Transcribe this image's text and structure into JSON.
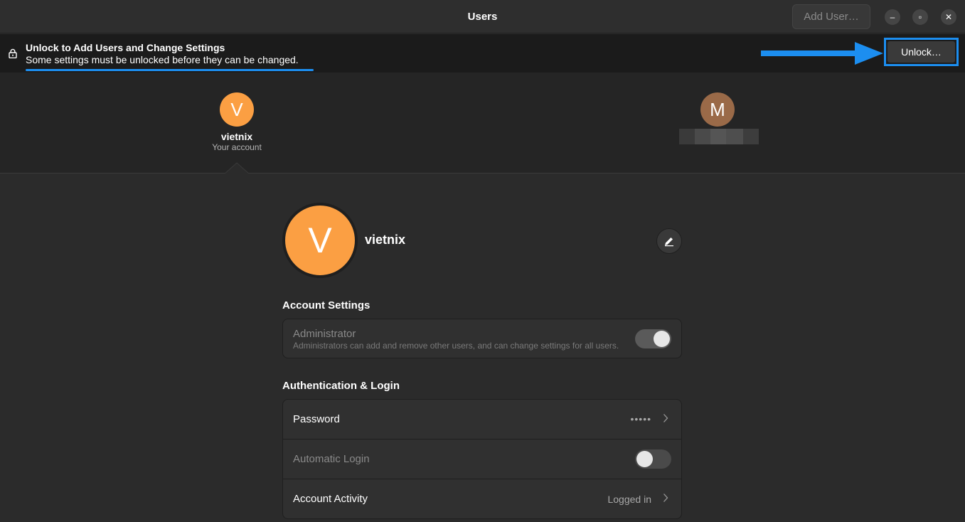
{
  "window": {
    "title": "Users",
    "add_user_label": "Add User…",
    "minimize_glyph": "–",
    "maximize_glyph": "▫",
    "close_glyph": "✕"
  },
  "banner": {
    "icon": "lock-icon",
    "title": "Unlock to Add Users and Change Settings",
    "subtitle": "Some settings must be unlocked before they can be changed.",
    "unlock_label": "Unlock…",
    "highlight_color": "#1c8ef0"
  },
  "users": [
    {
      "initial": "V",
      "name": "vietnix",
      "subtitle": "Your account",
      "color": "#fb9f43"
    },
    {
      "initial": "M",
      "name": "",
      "subtitle": "",
      "color": "#9a6a48"
    }
  ],
  "profile": {
    "initial": "V",
    "name": "vietnix",
    "color": "#fb9f43",
    "edit_icon": "pencil-icon"
  },
  "account_settings": {
    "heading": "Account Settings",
    "administrator": {
      "label": "Administrator",
      "description": "Administrators can add and remove other users, and can change settings for all users.",
      "enabled": true
    }
  },
  "auth_login": {
    "heading": "Authentication & Login",
    "password": {
      "label": "Password",
      "value": "•••••"
    },
    "automatic_login": {
      "label": "Automatic Login",
      "enabled": false
    },
    "account_activity": {
      "label": "Account Activity",
      "value": "Logged in"
    }
  }
}
